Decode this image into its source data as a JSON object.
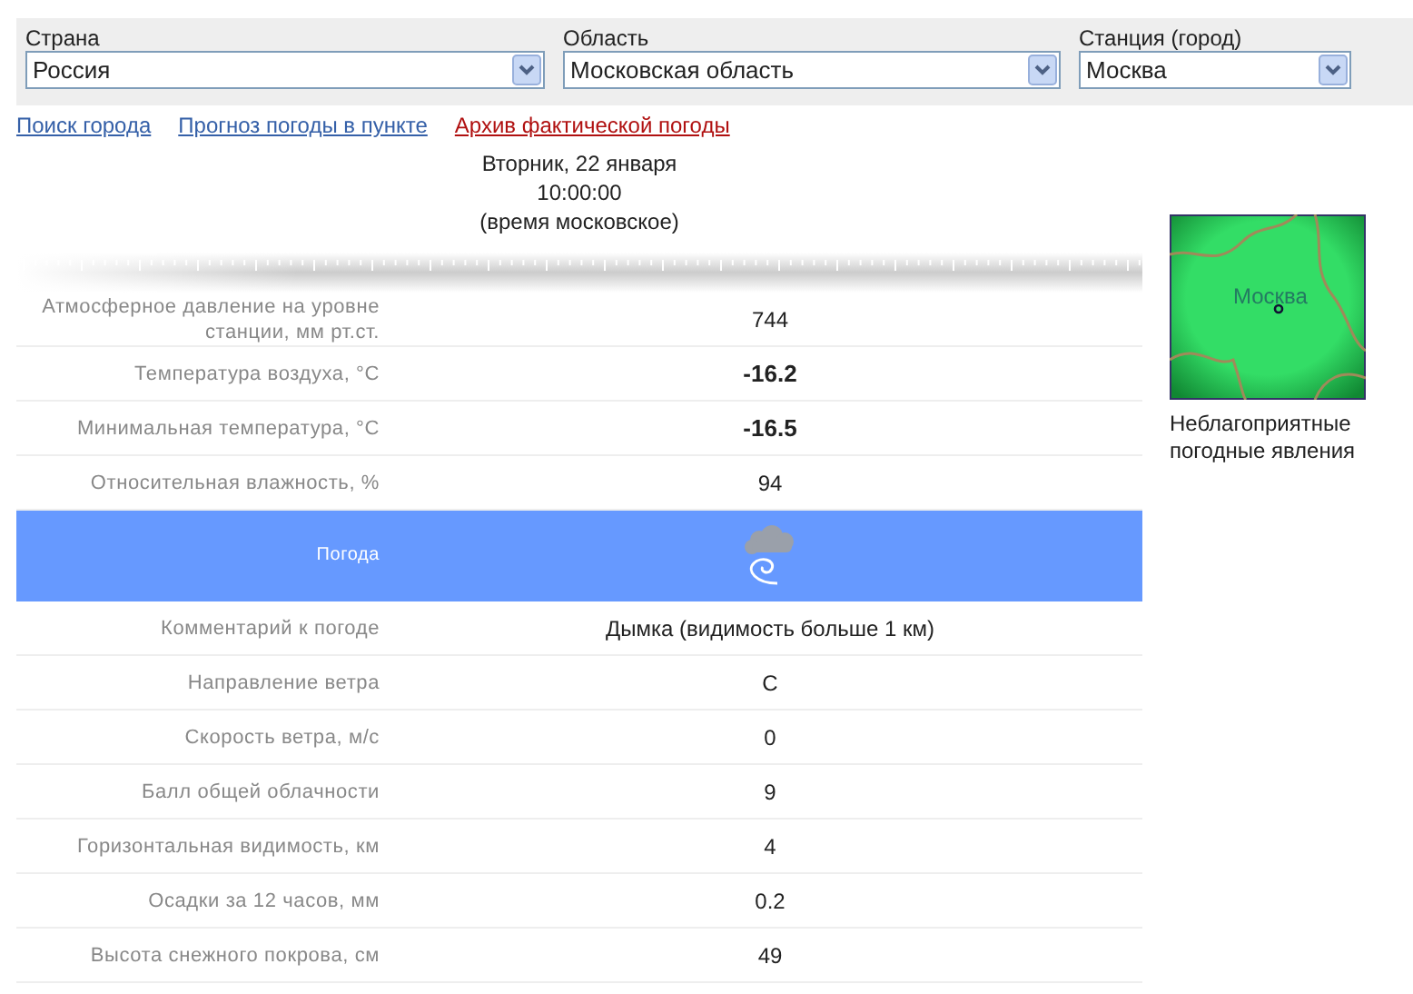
{
  "selectors": [
    {
      "label": "Страна",
      "value": "Россия"
    },
    {
      "label": "Область",
      "value": "Московская область"
    },
    {
      "label": "Станция (город)",
      "value": "Москва"
    }
  ],
  "links": [
    {
      "text": "Поиск города",
      "selected": false
    },
    {
      "text": "Прогноз погоды в пункте",
      "selected": false
    },
    {
      "text": "Архив фактической погоды",
      "selected": true
    }
  ],
  "date": {
    "day": "Вторник, 22 января",
    "time": "10:00:00",
    "zone": "(время московское)"
  },
  "rows": [
    {
      "kind": "value",
      "label": "Атмосферное давление на уровне станции, мм рт.ст.",
      "value": "744",
      "bold": false
    },
    {
      "kind": "value",
      "label": "Температура воздуха, °С",
      "value": "-16.2",
      "bold": true
    },
    {
      "kind": "value",
      "label": "Минимальная температура, °С",
      "value": "-16.5",
      "bold": true
    },
    {
      "kind": "value",
      "label": "Относительная влажность, %",
      "value": "94",
      "bold": false
    },
    {
      "kind": "weather",
      "label": "Погода"
    },
    {
      "kind": "value",
      "label": "Комментарий к погоде",
      "value": "Дымка (видимость больше 1 км)",
      "bold": false
    },
    {
      "kind": "value",
      "label": "Направление ветра",
      "value": "С",
      "bold": false
    },
    {
      "kind": "value",
      "label": "Скорость ветра, м/с",
      "value": "0",
      "bold": false
    },
    {
      "kind": "value",
      "label": "Балл общей облачности",
      "value": "9",
      "bold": false
    },
    {
      "kind": "value",
      "label": "Горизонтальная видимость, км",
      "value": "4",
      "bold": false
    },
    {
      "kind": "value",
      "label": "Осадки за 12 часов, мм",
      "value": "0.2",
      "bold": false
    },
    {
      "kind": "value",
      "label": "Высота снежного покрова, см",
      "value": "49",
      "bold": false
    }
  ],
  "map": {
    "city": "Москва",
    "caption": "Неблагоприятные погодные явления"
  }
}
